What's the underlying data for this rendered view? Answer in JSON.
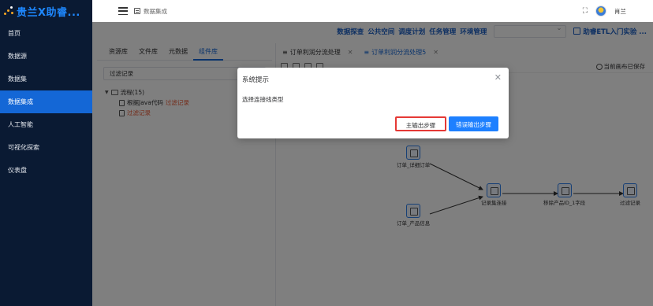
{
  "brand": {
    "title": "贵兰X助睿..."
  },
  "sidebar": {
    "items": [
      {
        "label": "首页"
      },
      {
        "label": "数据源"
      },
      {
        "label": "数据集"
      },
      {
        "label": "数据集成",
        "active": true
      },
      {
        "label": "人工智能"
      },
      {
        "label": "可视化探索"
      },
      {
        "label": "仪表盘"
      }
    ]
  },
  "header": {
    "breadcrumb": "数据集成",
    "user": "肖兰"
  },
  "subnav": {
    "links": [
      "数据探查",
      "公共空间",
      "调度计划",
      "任务管理",
      "环境管理"
    ],
    "guide": "助睿ETL入门实验 ..."
  },
  "leftpanel": {
    "tabs": [
      "资源库",
      "文件库",
      "元数据",
      "组件库"
    ],
    "active_tab": "组件库",
    "search_value": "过滤记录",
    "tree": {
      "folder": "流程(15)",
      "children": [
        {
          "prefix": "根据Java代码 ",
          "highlight": "过滤记录"
        },
        {
          "prefix": "",
          "highlight": "过滤记录"
        }
      ]
    }
  },
  "canvas": {
    "tabs": [
      {
        "label": "订单利润分流处理"
      },
      {
        "label": "订单利润分流处理5",
        "active": true
      }
    ],
    "saved_status": "当前画布已保存",
    "nodes": [
      "订单_详细订单",
      "订单_产品信息",
      "记录集连接",
      "移除产品ID_1字段",
      "过滤记录"
    ]
  },
  "dialog": {
    "title": "系统提示",
    "message": "选择连接线类型",
    "main_button": "主输出步骤",
    "error_button": "错误输出步骤"
  },
  "colors": {
    "sidebar_bg": "#0a1a33",
    "accent": "#1467d6",
    "highlight": "#e8542f",
    "primary_button": "#1e80ff",
    "focus_border": "#e53935"
  }
}
